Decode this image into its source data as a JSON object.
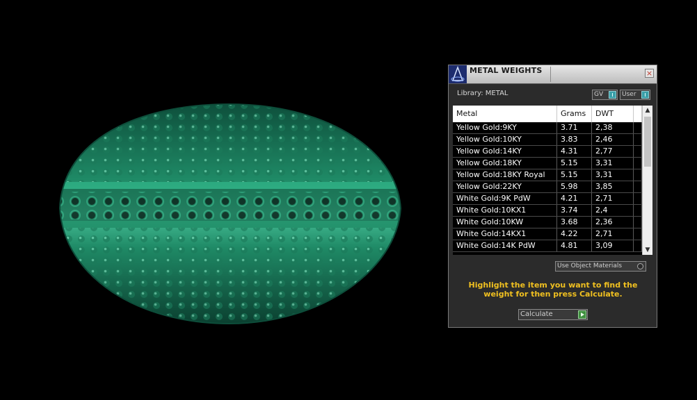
{
  "panel": {
    "title": "METAL WEIGHTS",
    "close_label": "×",
    "library_label": "Library: METAL",
    "gv_label": "GV",
    "user_label": "User",
    "use_materials_label": "Use Object Materials",
    "instructions": "Highlight the item you want to find the weight for then press Calculate.",
    "calculate_label": "Calculate"
  },
  "table": {
    "headers": [
      "Metal",
      "Grams",
      "DWT"
    ],
    "rows": [
      {
        "metal": "Yellow Gold:9KY",
        "grams": "3.71",
        "dwt": "2,38"
      },
      {
        "metal": "Yellow Gold:10KY",
        "grams": "3.83",
        "dwt": "2,46"
      },
      {
        "metal": "Yellow Gold:14KY",
        "grams": "4.31",
        "dwt": "2,77"
      },
      {
        "metal": "Yellow Gold:18KY",
        "grams": "5.15",
        "dwt": "3,31"
      },
      {
        "metal": "Yellow Gold:18KY Royal",
        "grams": "5.15",
        "dwt": "3,31"
      },
      {
        "metal": "Yellow Gold:22KY",
        "grams": "5.98",
        "dwt": "3,85"
      },
      {
        "metal": "White Gold:9K PdW",
        "grams": "4.21",
        "dwt": "2,71"
      },
      {
        "metal": "White Gold:10KX1",
        "grams": "3.74",
        "dwt": "2,4"
      },
      {
        "metal": "White Gold:10KW",
        "grams": "3.68",
        "dwt": "2,36"
      },
      {
        "metal": "White Gold:14KX1",
        "grams": "4.22",
        "dwt": "2,71"
      },
      {
        "metal": "White Gold:14K PdW",
        "grams": "4.81",
        "dwt": "3,09"
      }
    ]
  },
  "icons": {
    "app": "app-logo-icon",
    "close": "close-icon",
    "scroll_up": "scroll-up-arrow-icon",
    "scroll_down": "scroll-down-arrow-icon",
    "calculate": "play-arrow-icon"
  },
  "colors": {
    "ring": "#1b7a5a",
    "instructions": "#f0c020",
    "panel_bg": "#2b2b2b",
    "toggle_knob": "#3a9fa8"
  }
}
